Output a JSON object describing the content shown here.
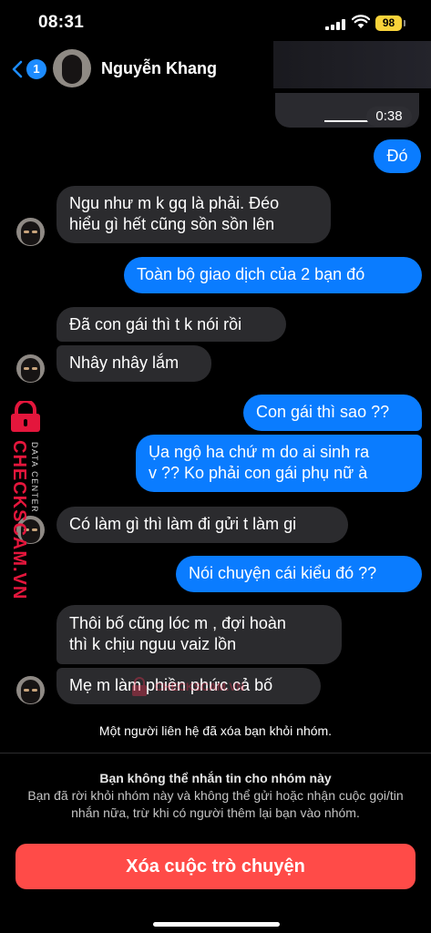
{
  "status": {
    "time": "08:31",
    "battery": "98"
  },
  "header": {
    "back_count": "1",
    "contact_name": "Nguyễn Khang"
  },
  "voice_message": {
    "duration": "0:38"
  },
  "messages": [
    {
      "side": "out",
      "text": "Đó"
    },
    {
      "side": "in",
      "lines": [
        "Ngu như m k gq là phải. Đéo",
        "hiểu gì hết cũng sồn sồn lên"
      ]
    },
    {
      "side": "out",
      "text": "Toàn bộ giao dịch của 2 bạn đó"
    },
    {
      "side": "in",
      "text": "Đã con gái thì t k nói rồi"
    },
    {
      "side": "in",
      "text": "Nhây nhây lắm"
    },
    {
      "side": "out",
      "text": "Con gái thì sao ??"
    },
    {
      "side": "out",
      "lines": [
        "Ụa ngộ ha chứ m do ai sinh ra",
        "v ?? Ko phải con gái phụ nữ à"
      ]
    },
    {
      "side": "in",
      "text": "Có làm gì thì làm đi gửi t làm gi"
    },
    {
      "side": "out",
      "text": "Nói chuyện cái kiểu đó ??"
    },
    {
      "side": "in",
      "lines": [
        "Thôi bố cũng lóc m , đợi hoàn",
        "thì k chịu nguu vaiz lồn"
      ]
    },
    {
      "side": "in",
      "text": "Mẹ m làm phiền phức cả bố"
    }
  ],
  "watermark": {
    "brand": "CHECKSCAM.VN",
    "sub": "DATA CENTER",
    "center": "CHECKSCAM.VN"
  },
  "notice": "Một người liên hệ đã xóa bạn khỏi nhóm.",
  "blocked": {
    "title": "Bạn không thể nhắn tin cho nhóm này",
    "description": "Bạn đã rời khỏi nhóm này và không thể gửi hoặc nhận cuộc gọi/tin nhắn nữa, trừ khi có người thêm lại bạn vào nhóm."
  },
  "delete_button": "Xóa cuộc trò chuyện",
  "colors": {
    "outgoing": "#0a7cff",
    "incoming": "#2b2b2e",
    "delete": "#ff4b48",
    "brand": "#e4163c"
  }
}
